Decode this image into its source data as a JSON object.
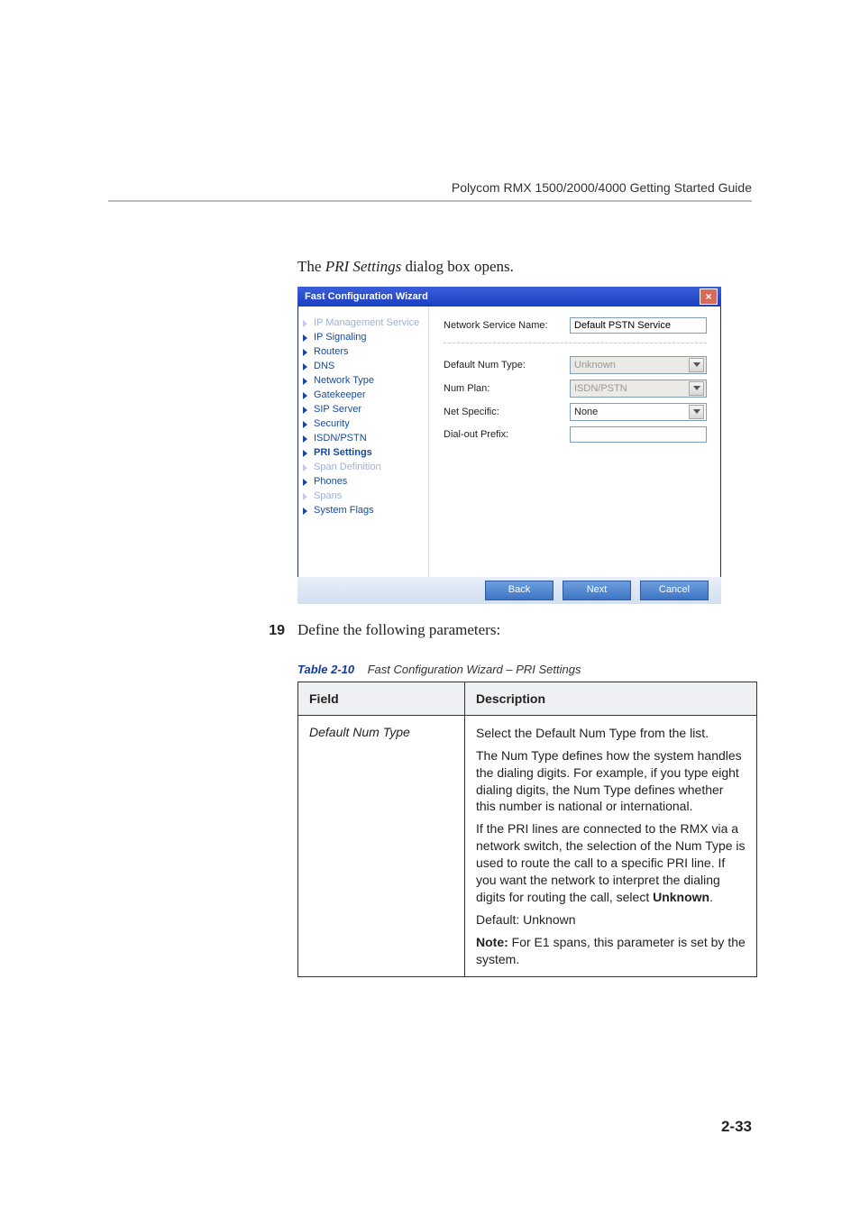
{
  "header": {
    "runhead": "Polycom RMX 1500/2000/4000 Getting Started Guide"
  },
  "intro": {
    "prefix": "The ",
    "italic": "PRI Settings",
    "suffix": " dialog box opens."
  },
  "dialog": {
    "title": "Fast Configuration Wizard",
    "close_glyph": "×",
    "nav": [
      {
        "label": "IP Management Service",
        "dim": true,
        "current": false
      },
      {
        "label": "IP Signaling",
        "dim": false,
        "current": false
      },
      {
        "label": "Routers",
        "dim": false,
        "current": false
      },
      {
        "label": "DNS",
        "dim": false,
        "current": false
      },
      {
        "label": "Network Type",
        "dim": false,
        "current": false
      },
      {
        "label": "Gatekeeper",
        "dim": false,
        "current": false
      },
      {
        "label": "SIP Server",
        "dim": false,
        "current": false
      },
      {
        "label": "Security",
        "dim": false,
        "current": false
      },
      {
        "label": "ISDN/PSTN",
        "dim": false,
        "current": false
      },
      {
        "label": "PRI Settings",
        "dim": false,
        "current": true
      },
      {
        "label": "Span Definition",
        "dim": true,
        "current": false
      },
      {
        "label": "Phones",
        "dim": false,
        "current": false
      },
      {
        "label": "Spans",
        "dim": true,
        "current": false
      },
      {
        "label": "System Flags",
        "dim": false,
        "current": false
      }
    ],
    "fields": {
      "network_service_name": {
        "label": "Network Service Name:",
        "value": "Default PSTN Service"
      },
      "default_num_type": {
        "label": "Default Num Type:",
        "value": "Unknown",
        "disabled": true
      },
      "num_plan": {
        "label": "Num Plan:",
        "value": "ISDN/PSTN",
        "disabled": true
      },
      "net_specific": {
        "label": "Net Specific:",
        "value": "None",
        "disabled": false
      },
      "dial_out_prefix": {
        "label": "Dial-out Prefix:",
        "value": ""
      }
    },
    "buttons": {
      "back": "Back",
      "next": "Next",
      "cancel": "Cancel"
    }
  },
  "step": {
    "num": "19",
    "text": "Define the following parameters:"
  },
  "table": {
    "caption_num": "Table 2-10",
    "caption_title": "Fast Configuration Wizard – PRI Settings",
    "head_field": "Field",
    "head_desc": "Description",
    "rows": [
      {
        "field": "Default Num Type",
        "desc": {
          "p1": "Select the Default Num Type from the list.",
          "p2": "The Num Type defines how the system handles the dialing digits. For example, if you type eight dialing digits, the Num Type defines whether this number is national or international.",
          "p3_a": "If the PRI lines are connected to the RMX via a network switch, the selection of the Num Type is used to route the call to a specific PRI line. If you want the network to interpret the dialing digits for routing the call, select ",
          "p3_bold": "Unknown",
          "p3_b": ".",
          "p4": "Default: Unknown",
          "p5_label": "Note:",
          "p5_text": " For E1 spans, this parameter is set by the system."
        }
      }
    ]
  },
  "page_number": "2-33"
}
